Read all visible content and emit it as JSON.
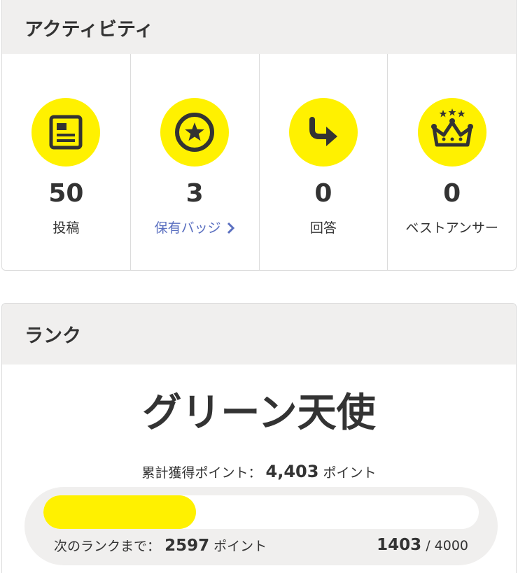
{
  "activity": {
    "title": "アクティビティ",
    "stats": [
      {
        "icon": "article-icon",
        "value": "50",
        "label": "投稿"
      },
      {
        "icon": "star-badge-icon",
        "value": "3",
        "label": "保有バッジ",
        "chevron": "chevron-right-icon"
      },
      {
        "icon": "reply-arrow-icon",
        "value": "0",
        "label": "回答"
      },
      {
        "icon": "crown-icon",
        "value": "0",
        "label": "ベストアンサー"
      }
    ]
  },
  "rank": {
    "title": "ランク",
    "name": "グリーン天使",
    "total_label": "累計獲得ポイント：",
    "total_value": "4,403",
    "total_unit": "ポイント",
    "next_label": "次のランクまで：",
    "next_value": "2597",
    "next_unit": "ポイント",
    "current": "1403",
    "separator": " / ",
    "max": "4000",
    "progress": 0.35
  },
  "colors": {
    "accent": "#fff100",
    "link": "#5a6fc0",
    "header_bg": "#f0efee"
  }
}
